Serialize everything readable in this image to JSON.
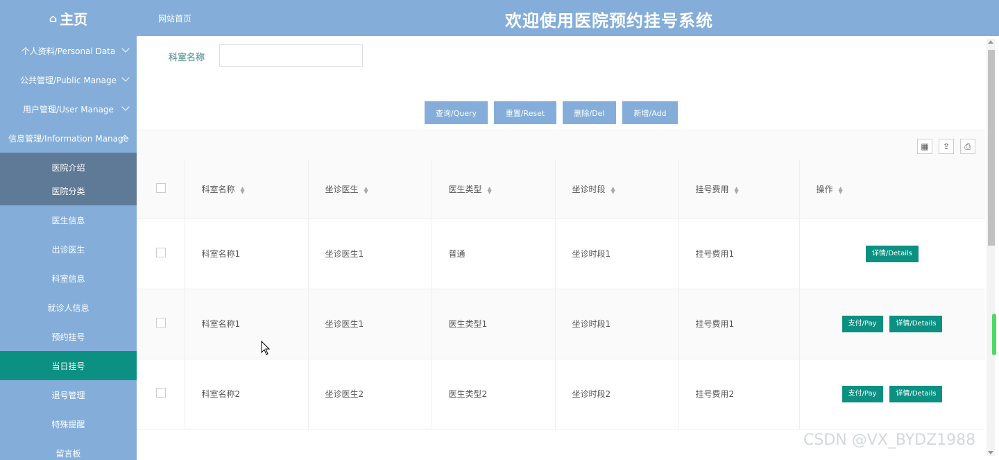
{
  "header": {
    "brand": "主页",
    "brand_icon": "home-icon",
    "breadcrumb": "网站首页",
    "title": "欢迎使用医院预约挂号系统",
    "color": "#84aed9"
  },
  "sidebar": {
    "items": [
      {
        "label": "个人资料/Personal Data",
        "chevron": "down"
      },
      {
        "label": "公共管理/Public Manage",
        "chevron": "down"
      },
      {
        "label": "用户管理/User Manage",
        "chevron": "down"
      },
      {
        "label": "信息管理/Information Manage",
        "chevron": "up"
      }
    ],
    "dark_sub": [
      {
        "label": "医院介绍"
      },
      {
        "label": "医院分类"
      }
    ],
    "sub_items": [
      {
        "label": "医生信息"
      },
      {
        "label": "出诊医生"
      },
      {
        "label": "科室信息"
      },
      {
        "label": "就诊人信息"
      },
      {
        "label": "预约挂号"
      },
      {
        "label": "当日挂号",
        "active": true
      },
      {
        "label": "退号管理"
      },
      {
        "label": "特殊提醒"
      },
      {
        "label": "留言板"
      }
    ],
    "active_color": "#0b9081"
  },
  "search": {
    "label": "科室名称",
    "value": "",
    "placeholder": ""
  },
  "buttons": {
    "query": "查询/Query",
    "reset": "重置/Reset",
    "delete": "删除/Del",
    "add": "新增/Add"
  },
  "toolbar": {
    "icons": [
      "columns-icon",
      "export-icon",
      "print-icon"
    ]
  },
  "table": {
    "columns": [
      "科室名称",
      "坐诊医生",
      "医生类型",
      "坐诊时段",
      "挂号费用",
      "操作"
    ],
    "rows": [
      {
        "cells": [
          "科室名称1",
          "坐诊医生1",
          "普通",
          "坐诊时段1",
          "挂号费用1"
        ],
        "actions": [
          "详情/Details"
        ]
      },
      {
        "cells": [
          "科室名称1",
          "坐诊医生1",
          "医生类型1",
          "坐诊时段1",
          "挂号费用1"
        ],
        "actions": [
          "支付/Pay",
          "详情/Details"
        ]
      },
      {
        "cells": [
          "科室名称2",
          "坐诊医生2",
          "医生类型2",
          "坐诊时段2",
          "挂号费用2"
        ],
        "actions": [
          "支付/Pay",
          "详情/Details"
        ]
      }
    ]
  },
  "watermark": "CSDN @VX_BYDZ1988"
}
